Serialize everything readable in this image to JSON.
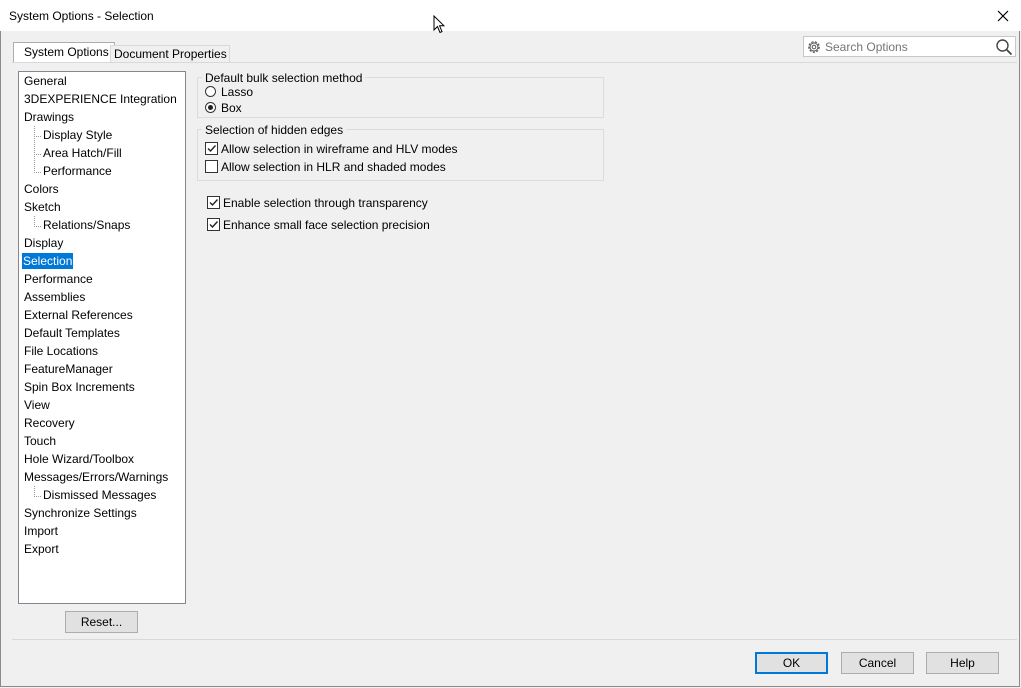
{
  "window": {
    "title": "System Options - Selection"
  },
  "tabs": [
    {
      "label": "System Options",
      "active": true
    },
    {
      "label": "Document Properties",
      "active": false
    }
  ],
  "search": {
    "placeholder": "Search Options"
  },
  "tree": {
    "items": [
      {
        "label": "General",
        "level": 0
      },
      {
        "label": "3DEXPERIENCE Integration",
        "level": 0
      },
      {
        "label": "Drawings",
        "level": 0
      },
      {
        "label": "Display Style",
        "level": 1
      },
      {
        "label": "Area Hatch/Fill",
        "level": 1
      },
      {
        "label": "Performance",
        "level": 1
      },
      {
        "label": "Colors",
        "level": 0
      },
      {
        "label": "Sketch",
        "level": 0
      },
      {
        "label": "Relations/Snaps",
        "level": 1
      },
      {
        "label": "Display",
        "level": 0
      },
      {
        "label": "Selection",
        "level": 0,
        "selected": true
      },
      {
        "label": "Performance",
        "level": 0
      },
      {
        "label": "Assemblies",
        "level": 0
      },
      {
        "label": "External References",
        "level": 0
      },
      {
        "label": "Default Templates",
        "level": 0
      },
      {
        "label": "File Locations",
        "level": 0
      },
      {
        "label": "FeatureManager",
        "level": 0
      },
      {
        "label": "Spin Box Increments",
        "level": 0
      },
      {
        "label": "View",
        "level": 0
      },
      {
        "label": "Recovery",
        "level": 0
      },
      {
        "label": "Touch",
        "level": 0
      },
      {
        "label": "Hole Wizard/Toolbox",
        "level": 0
      },
      {
        "label": "Messages/Errors/Warnings",
        "level": 0
      },
      {
        "label": "Dismissed Messages",
        "level": 1
      },
      {
        "label": "Synchronize Settings",
        "level": 0
      },
      {
        "label": "Import",
        "level": 0
      },
      {
        "label": "Export",
        "level": 0
      }
    ]
  },
  "reset_button": "Reset...",
  "bulk_selection": {
    "title": "Default bulk selection method",
    "options": [
      {
        "label": "Lasso",
        "checked": false
      },
      {
        "label": "Box",
        "checked": true
      }
    ]
  },
  "hidden_edges": {
    "title": "Selection of hidden edges",
    "options": [
      {
        "label": "Allow selection in wireframe and HLV modes",
        "checked": true
      },
      {
        "label": "Allow selection in HLR and shaded modes",
        "checked": false
      }
    ]
  },
  "misc_options": [
    {
      "label": "Enable selection through transparency",
      "checked": true
    },
    {
      "label": "Enhance small face selection precision",
      "checked": true
    }
  ],
  "footer": {
    "ok": "OK",
    "cancel": "Cancel",
    "help": "Help"
  },
  "colors": {
    "selection": "#0078d7",
    "default_button_border": "#0078d7"
  }
}
